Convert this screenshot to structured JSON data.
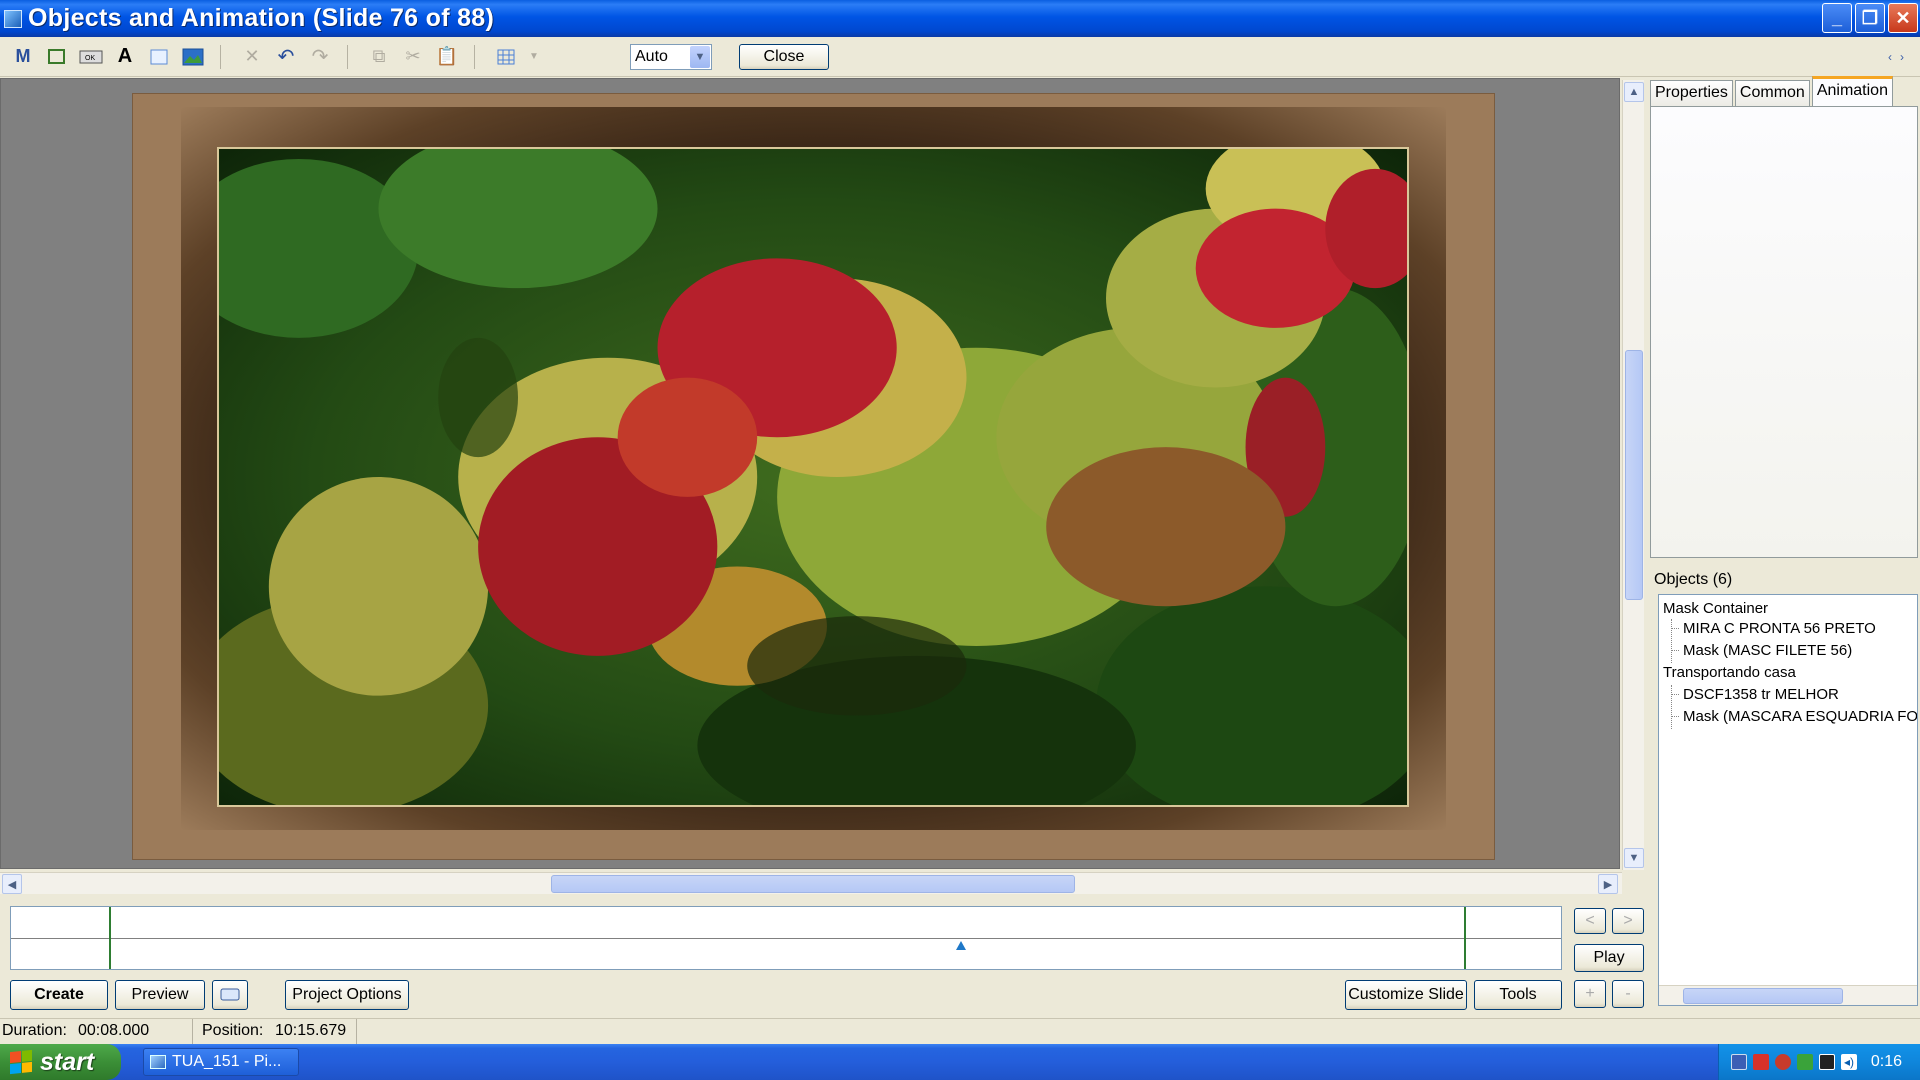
{
  "window": {
    "title": "Objects and Animation  (Slide 76 of 88)",
    "controls": {
      "minimize": "_",
      "maximize": "❐",
      "close": "✕"
    }
  },
  "toolbar": {
    "icons": [
      "text-style-icon",
      "rectangle-icon",
      "button-icon",
      "text-icon",
      "frame-icon",
      "image-icon",
      "delete-icon",
      "undo-icon",
      "redo-icon",
      "copy-icon",
      "cut-icon",
      "paste-icon",
      "grid-icon"
    ],
    "zoom_combo": "Auto",
    "close_button": "Close",
    "nav_prev": "‹",
    "nav_next": "›"
  },
  "timeline": {
    "play_button": "Play",
    "prev": "<",
    "next": ">",
    "add": "+",
    "remove": "-"
  },
  "bottom_buttons": {
    "create": "Create",
    "preview": "Preview",
    "project_options": "Project Options",
    "customize_slide": "Customize Slide",
    "tools": "Tools"
  },
  "right_panel": {
    "tabs": [
      "Properties",
      "Common",
      "Animation"
    ],
    "active_tab": "Animation",
    "objects_label": "Objects (6)",
    "objects": [
      {
        "label": "Mask Container",
        "level": 0
      },
      {
        "label": "MIRA  C PRONTA 56 PRETO",
        "level": 1
      },
      {
        "label": "Mask (MASC FILETE 56)",
        "level": 1
      },
      {
        "label": "Transportando casa",
        "level": 0
      },
      {
        "label": "DSCF1358 tr MELHOR",
        "level": 1
      },
      {
        "label": "Mask (MASCARA ESQUADRIA FOTO)",
        "level": 1
      }
    ]
  },
  "status": {
    "duration_label": "Duration:",
    "duration_value": "00:08.000",
    "position_label": "Position:",
    "position_value": "10:15.679"
  },
  "taskbar": {
    "start": "start",
    "task_label": "TUA_151 - Pi...",
    "clock": "0:16"
  },
  "colors": {
    "title_blue": "#0055e5",
    "slide_brown": "#9c7b5a",
    "canvas_gray": "#808080",
    "tab_accent": "#f5a623"
  }
}
